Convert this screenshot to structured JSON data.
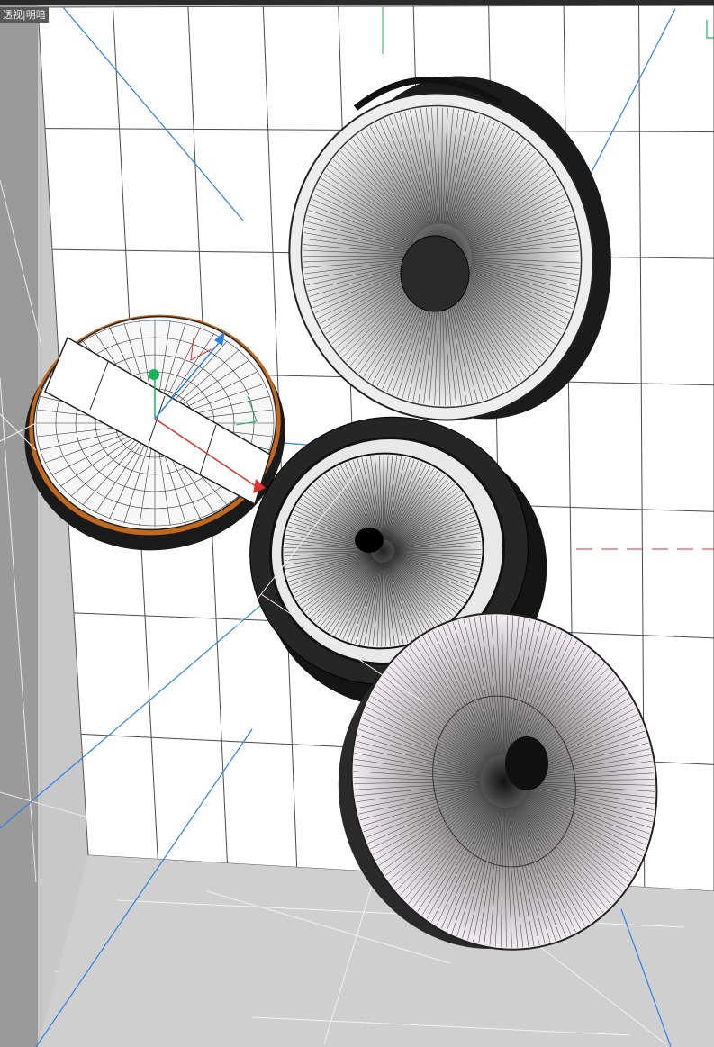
{
  "viewport": {
    "label": "透视|明暗",
    "colors": {
      "background": "#c8c8c8",
      "grid_panel": "#ffffff",
      "grid_line": "#444444",
      "wire_dark": "#111111",
      "wire_light": "#bbbbbb",
      "accent_blue": "#2f7fe8",
      "axis_red": "#e03030",
      "axis_green": "#19b35a",
      "edge_orange": "#c0681e"
    }
  },
  "gizmo": {
    "axes": [
      "x-axis",
      "y-axis",
      "z-axis"
    ],
    "icons": [
      "move-gizmo-icon",
      "view-axis-indicator-icon"
    ]
  }
}
